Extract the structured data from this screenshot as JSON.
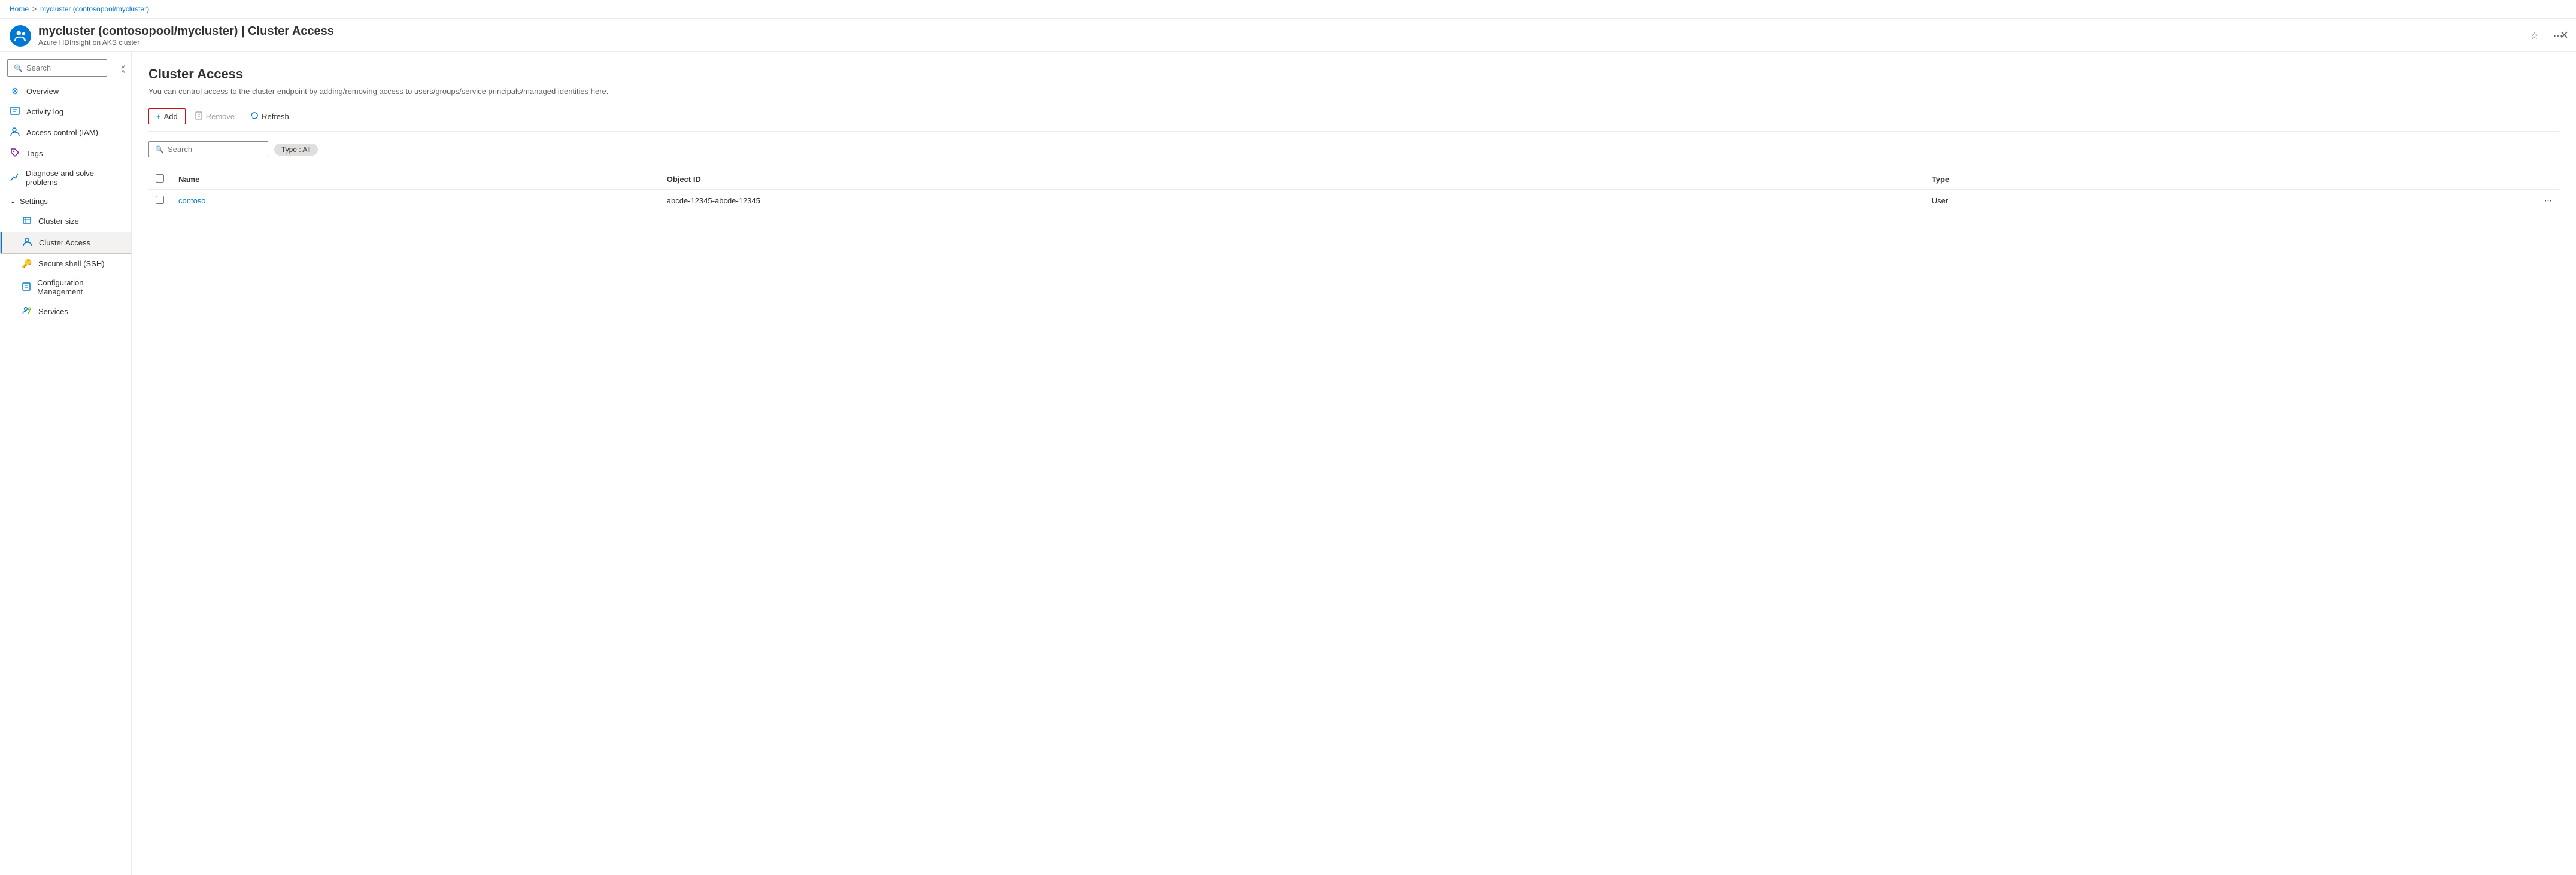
{
  "breadcrumb": {
    "home": "Home",
    "separator": ">",
    "current": "mycluster (contosopool/mycluster)"
  },
  "header": {
    "title": "mycluster (contosopool/mycluster) | Cluster Access",
    "subtitle": "Azure HDInsight on AKS cluster",
    "icon": "👥"
  },
  "sidebar": {
    "search_placeholder": "Search",
    "items": [
      {
        "id": "overview",
        "label": "Overview",
        "icon": "⚙",
        "active": false
      },
      {
        "id": "activity-log",
        "label": "Activity log",
        "icon": "📋",
        "active": false
      },
      {
        "id": "access-control",
        "label": "Access control (IAM)",
        "icon": "👤",
        "active": false
      },
      {
        "id": "tags",
        "label": "Tags",
        "icon": "🏷",
        "active": false
      },
      {
        "id": "diagnose",
        "label": "Diagnose and solve problems",
        "icon": "🔧",
        "active": false
      }
    ],
    "settings_label": "Settings",
    "settings_items": [
      {
        "id": "cluster-size",
        "label": "Cluster size",
        "icon": "📝",
        "active": false
      },
      {
        "id": "cluster-access",
        "label": "Cluster Access",
        "icon": "👥",
        "active": true
      },
      {
        "id": "ssh",
        "label": "Secure shell (SSH)",
        "icon": "🔑",
        "active": false
      },
      {
        "id": "config-management",
        "label": "Configuration Management",
        "icon": "📄",
        "active": false
      },
      {
        "id": "services",
        "label": "Services",
        "icon": "👥",
        "active": false
      }
    ]
  },
  "content": {
    "title": "Cluster Access",
    "description": "You can control access to the cluster endpoint by adding/removing access to users/groups/service principals/managed identities here.",
    "toolbar": {
      "add_label": "Add",
      "remove_label": "Remove",
      "refresh_label": "Refresh"
    },
    "filter": {
      "search_placeholder": "Search",
      "type_label": "Type : All"
    },
    "table": {
      "columns": [
        "Name",
        "Object ID",
        "Type"
      ],
      "rows": [
        {
          "name": "contoso",
          "object_id": "abcde-12345-abcde-12345",
          "type": "User"
        }
      ]
    }
  }
}
